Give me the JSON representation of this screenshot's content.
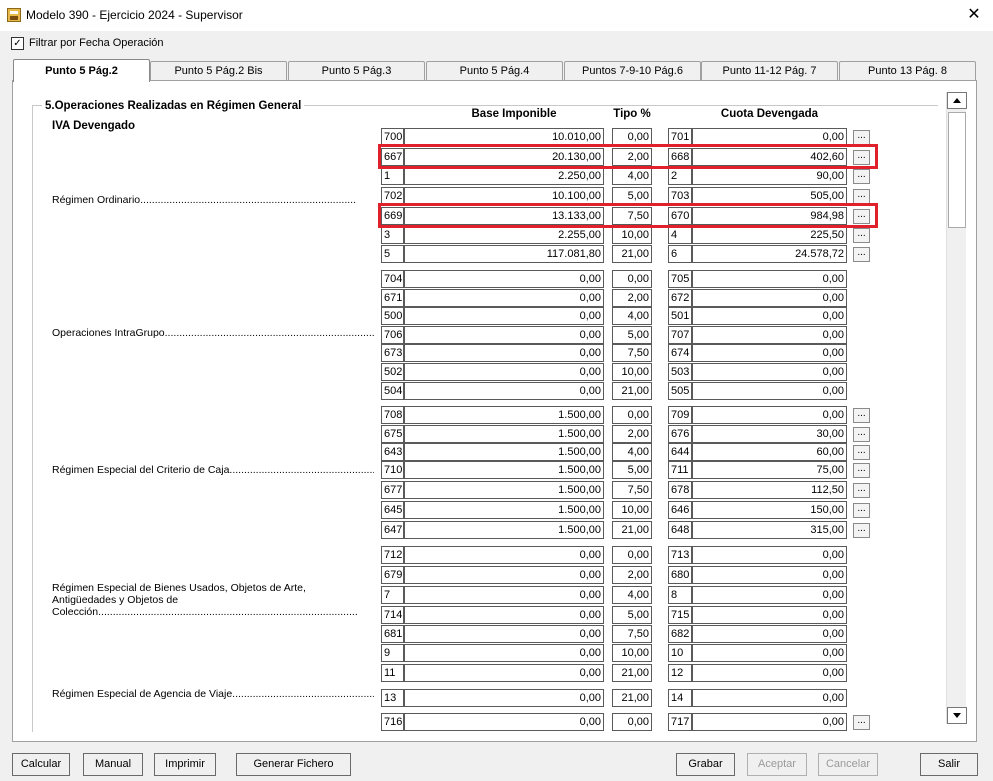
{
  "window": {
    "title": "Modelo 390 - Ejercicio 2024 - Supervisor",
    "close_glyph": "✕"
  },
  "filter": {
    "label": "Filtrar por Fecha Operación",
    "checked": true
  },
  "tabs": [
    {
      "label": "Punto 5 Pág.2",
      "active": true
    },
    {
      "label": "Punto 5 Pág.2 Bis",
      "active": false
    },
    {
      "label": "Punto 5 Pág.3",
      "active": false
    },
    {
      "label": "Punto 5 Pág.4",
      "active": false
    },
    {
      "label": "Puntos 7-9-10 Pág.6",
      "active": false
    },
    {
      "label": "Punto 11-12 Pág. 7",
      "active": false
    },
    {
      "label": "Punto 13 Pág. 8",
      "active": false
    }
  ],
  "group": {
    "title": "5.Operaciones Realizadas en Régimen General",
    "subtitle": "IVA Devengado"
  },
  "headers": {
    "base": "Base Imponible",
    "tipo": "Tipo %",
    "cuota": "Cuota Devengada"
  },
  "sections": [
    {
      "label": "Régimen Ordinario.........................................................................."
    },
    {
      "label": "Operaciones IntraGrupo.............................................................................."
    },
    {
      "label": "Régimen Especial del Criterio de Caja...................................................."
    },
    {
      "label": "Régimen Especial de Bienes Usados, Objetos de Arte,\nAntigüedades y Objetos de\nColección........................................................................................."
    },
    {
      "label": "Régimen Especial de Agencia de Viaje........................................................"
    }
  ],
  "rows": [
    {
      "c1": "700",
      "base": "10.010,00",
      "tipo": "0,00",
      "c2": "701",
      "cuota": "0,00",
      "btn": true
    },
    {
      "c1": "667",
      "base": "20.130,00",
      "tipo": "2,00",
      "c2": "668",
      "cuota": "402,60",
      "btn": true
    },
    {
      "c1": "1",
      "base": "2.250,00",
      "tipo": "4,00",
      "c2": "2",
      "cuota": "90,00",
      "btn": true
    },
    {
      "c1": "702",
      "base": "10.100,00",
      "tipo": "5,00",
      "c2": "703",
      "cuota": "505,00",
      "btn": true
    },
    {
      "c1": "669",
      "base": "13.133,00",
      "tipo": "7,50",
      "c2": "670",
      "cuota": "984,98",
      "btn": true
    },
    {
      "c1": "3",
      "base": "2.255,00",
      "tipo": "10,00",
      "c2": "4",
      "cuota": "225,50",
      "btn": true
    },
    {
      "c1": "5",
      "base": "117.081,80",
      "tipo": "21,00",
      "c2": "6",
      "cuota": "24.578,72",
      "btn": true
    },
    {
      "c1": "704",
      "base": "0,00",
      "tipo": "0,00",
      "c2": "705",
      "cuota": "0,00",
      "btn": false
    },
    {
      "c1": "671",
      "base": "0,00",
      "tipo": "2,00",
      "c2": "672",
      "cuota": "0,00",
      "btn": false
    },
    {
      "c1": "500",
      "base": "0,00",
      "tipo": "4,00",
      "c2": "501",
      "cuota": "0,00",
      "btn": false
    },
    {
      "c1": "706",
      "base": "0,00",
      "tipo": "5,00",
      "c2": "707",
      "cuota": "0,00",
      "btn": false
    },
    {
      "c1": "673",
      "base": "0,00",
      "tipo": "7,50",
      "c2": "674",
      "cuota": "0,00",
      "btn": false
    },
    {
      "c1": "502",
      "base": "0,00",
      "tipo": "10,00",
      "c2": "503",
      "cuota": "0,00",
      "btn": false
    },
    {
      "c1": "504",
      "base": "0,00",
      "tipo": "21,00",
      "c2": "505",
      "cuota": "0,00",
      "btn": false
    },
    {
      "c1": "708",
      "base": "1.500,00",
      "tipo": "0,00",
      "c2": "709",
      "cuota": "0,00",
      "btn": true
    },
    {
      "c1": "675",
      "base": "1.500,00",
      "tipo": "2,00",
      "c2": "676",
      "cuota": "30,00",
      "btn": true
    },
    {
      "c1": "643",
      "base": "1.500,00",
      "tipo": "4,00",
      "c2": "644",
      "cuota": "60,00",
      "btn": true
    },
    {
      "c1": "710",
      "base": "1.500,00",
      "tipo": "5,00",
      "c2": "711",
      "cuota": "75,00",
      "btn": true
    },
    {
      "c1": "677",
      "base": "1.500,00",
      "tipo": "7,50",
      "c2": "678",
      "cuota": "112,50",
      "btn": true
    },
    {
      "c1": "645",
      "base": "1.500,00",
      "tipo": "10,00",
      "c2": "646",
      "cuota": "150,00",
      "btn": true
    },
    {
      "c1": "647",
      "base": "1.500,00",
      "tipo": "21,00",
      "c2": "648",
      "cuota": "315,00",
      "btn": true
    },
    {
      "c1": "712",
      "base": "0,00",
      "tipo": "0,00",
      "c2": "713",
      "cuota": "0,00",
      "btn": false
    },
    {
      "c1": "679",
      "base": "0,00",
      "tipo": "2,00",
      "c2": "680",
      "cuota": "0,00",
      "btn": false
    },
    {
      "c1": "7",
      "base": "0,00",
      "tipo": "4,00",
      "c2": "8",
      "cuota": "0,00",
      "btn": false
    },
    {
      "c1": "714",
      "base": "0,00",
      "tipo": "5,00",
      "c2": "715",
      "cuota": "0,00",
      "btn": false
    },
    {
      "c1": "681",
      "base": "0,00",
      "tipo": "7,50",
      "c2": "682",
      "cuota": "0,00",
      "btn": false
    },
    {
      "c1": "9",
      "base": "0,00",
      "tipo": "10,00",
      "c2": "10",
      "cuota": "0,00",
      "btn": false
    },
    {
      "c1": "11",
      "base": "0,00",
      "tipo": "21,00",
      "c2": "12",
      "cuota": "0,00",
      "btn": false
    },
    {
      "c1": "13",
      "base": "0,00",
      "tipo": "21,00",
      "c2": "14",
      "cuota": "0,00",
      "btn": false
    },
    {
      "c1": "716",
      "base": "0,00",
      "tipo": "0,00",
      "c2": "717",
      "cuota": "0,00",
      "btn": true
    }
  ],
  "row_button_label": "...",
  "highlight_color": "#e0202a",
  "buttons": [
    {
      "label": "Calcular",
      "enabled": true
    },
    {
      "label": "Manual",
      "enabled": true
    },
    {
      "label": "Imprimir",
      "enabled": true
    },
    {
      "label": "Generar Fichero",
      "enabled": true
    },
    {
      "label": "Grabar",
      "enabled": true
    },
    {
      "label": "Aceptar",
      "enabled": false
    },
    {
      "label": "Cancelar",
      "enabled": false
    },
    {
      "label": "Salir",
      "enabled": true
    }
  ]
}
